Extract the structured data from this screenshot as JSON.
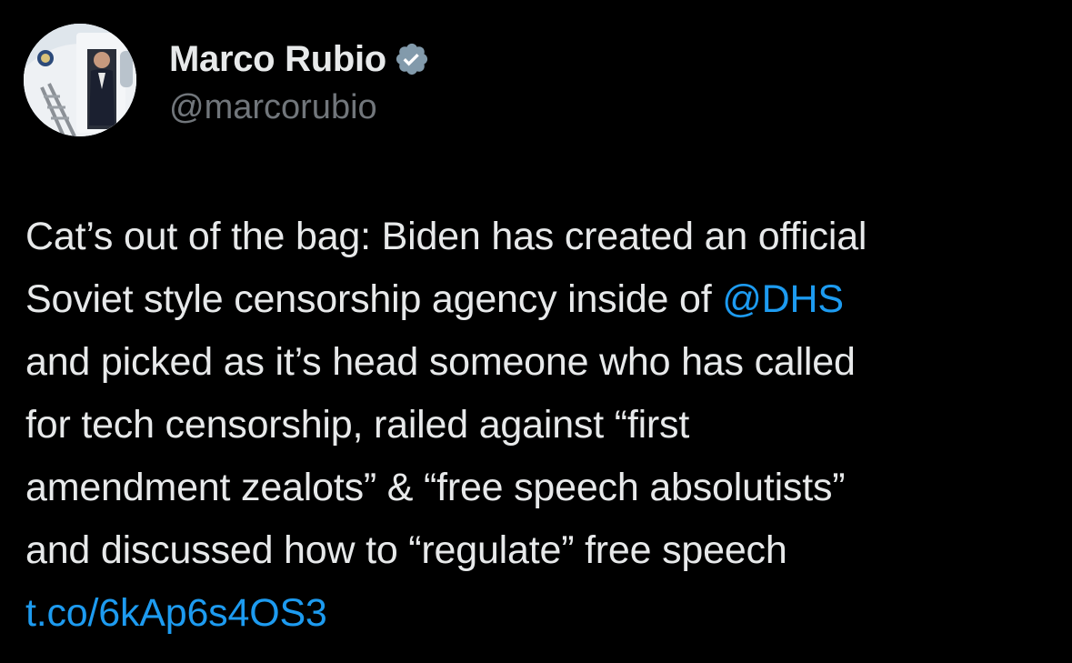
{
  "tweet": {
    "author": {
      "display_name": "Marco Rubio",
      "handle": "@marcorubio",
      "verified_icon": "verified-badge-icon",
      "avatar_icon": "avatar"
    },
    "text_lines": [
      {
        "before": "Cat’s out of the bag: Biden has created an official",
        "link": "",
        "after": ""
      },
      {
        "before": "Soviet style censorship agency inside of ",
        "link": "@DHS",
        "after": ""
      },
      {
        "before": "and picked as it’s head someone who has called",
        "link": "",
        "after": ""
      },
      {
        "before": "for tech censorship, railed against “first",
        "link": "",
        "after": ""
      },
      {
        "before": "amendment zealots” & “free speech absolutists”",
        "link": "",
        "after": ""
      },
      {
        "before": "and discussed how to “regulate” free speech",
        "link": "",
        "after": ""
      },
      {
        "before": "",
        "link": "t.co/6kAp6s4OS3",
        "after": ""
      }
    ]
  },
  "colors": {
    "background": "#000000",
    "text": "#e7e9ea",
    "secondary_text": "#71767b",
    "link": "#1d9bf0",
    "verified_badge": "#829aab"
  }
}
